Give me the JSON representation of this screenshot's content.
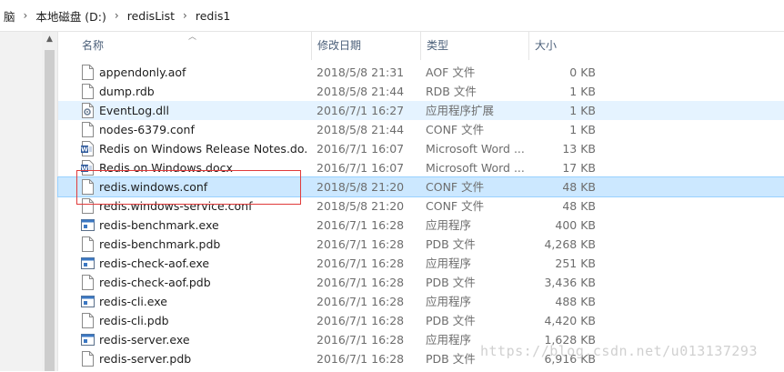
{
  "breadcrumb": [
    "脑",
    "本地磁盘 (D:)",
    "redisList",
    "redis1"
  ],
  "columns": {
    "name": "名称",
    "date": "修改日期",
    "type": "类型",
    "size": "大小"
  },
  "files": [
    {
      "name": "appendonly.aof",
      "date": "2018/5/8 21:31",
      "type": "AOF 文件",
      "size": "0 KB",
      "icon": "generic-file-icon"
    },
    {
      "name": "dump.rdb",
      "date": "2018/5/8 21:44",
      "type": "RDB 文件",
      "size": "1 KB",
      "icon": "generic-file-icon"
    },
    {
      "name": "EventLog.dll",
      "date": "2016/7/1 16:27",
      "type": "应用程序扩展",
      "size": "1 KB",
      "icon": "dll-gear-icon"
    },
    {
      "name": "nodes-6379.conf",
      "date": "2018/5/8 21:44",
      "type": "CONF 文件",
      "size": "1 KB",
      "icon": "generic-file-icon"
    },
    {
      "name": "Redis on Windows Release Notes.do...",
      "date": "2016/7/1 16:07",
      "type": "Microsoft Word ...",
      "size": "13 KB",
      "icon": "word-document-icon"
    },
    {
      "name": "Redis on Windows.docx",
      "date": "2016/7/1 16:07",
      "type": "Microsoft Word ...",
      "size": "17 KB",
      "icon": "word-document-icon"
    },
    {
      "name": "redis.windows.conf",
      "date": "2018/5/8 21:20",
      "type": "CONF 文件",
      "size": "48 KB",
      "icon": "generic-file-icon"
    },
    {
      "name": "redis.windows-service.conf",
      "date": "2018/5/8 21:20",
      "type": "CONF 文件",
      "size": "48 KB",
      "icon": "generic-file-icon"
    },
    {
      "name": "redis-benchmark.exe",
      "date": "2016/7/1 16:28",
      "type": "应用程序",
      "size": "400 KB",
      "icon": "executable-icon"
    },
    {
      "name": "redis-benchmark.pdb",
      "date": "2016/7/1 16:28",
      "type": "PDB 文件",
      "size": "4,268 KB",
      "icon": "generic-file-icon"
    },
    {
      "name": "redis-check-aof.exe",
      "date": "2016/7/1 16:28",
      "type": "应用程序",
      "size": "251 KB",
      "icon": "executable-icon"
    },
    {
      "name": "redis-check-aof.pdb",
      "date": "2016/7/1 16:28",
      "type": "PDB 文件",
      "size": "3,436 KB",
      "icon": "generic-file-icon"
    },
    {
      "name": "redis-cli.exe",
      "date": "2016/7/1 16:28",
      "type": "应用程序",
      "size": "488 KB",
      "icon": "executable-icon"
    },
    {
      "name": "redis-cli.pdb",
      "date": "2016/7/1 16:28",
      "type": "PDB 文件",
      "size": "4,420 KB",
      "icon": "generic-file-icon"
    },
    {
      "name": "redis-server.exe",
      "date": "2016/7/1 16:28",
      "type": "应用程序",
      "size": "1,628 KB",
      "icon": "executable-icon"
    },
    {
      "name": "redis-server.pdb",
      "date": "2016/7/1 16:28",
      "type": "PDB 文件",
      "size": "6,916 KB",
      "icon": "generic-file-icon"
    }
  ],
  "hover_row": 2,
  "selected_row": 6,
  "watermark": "https://blog.csdn.net/u013137293",
  "colors": {
    "selected": "#cce8ff",
    "hover": "#e5f3ff",
    "highlight_box": "#e03a3a",
    "header_text": "#4c607a"
  }
}
